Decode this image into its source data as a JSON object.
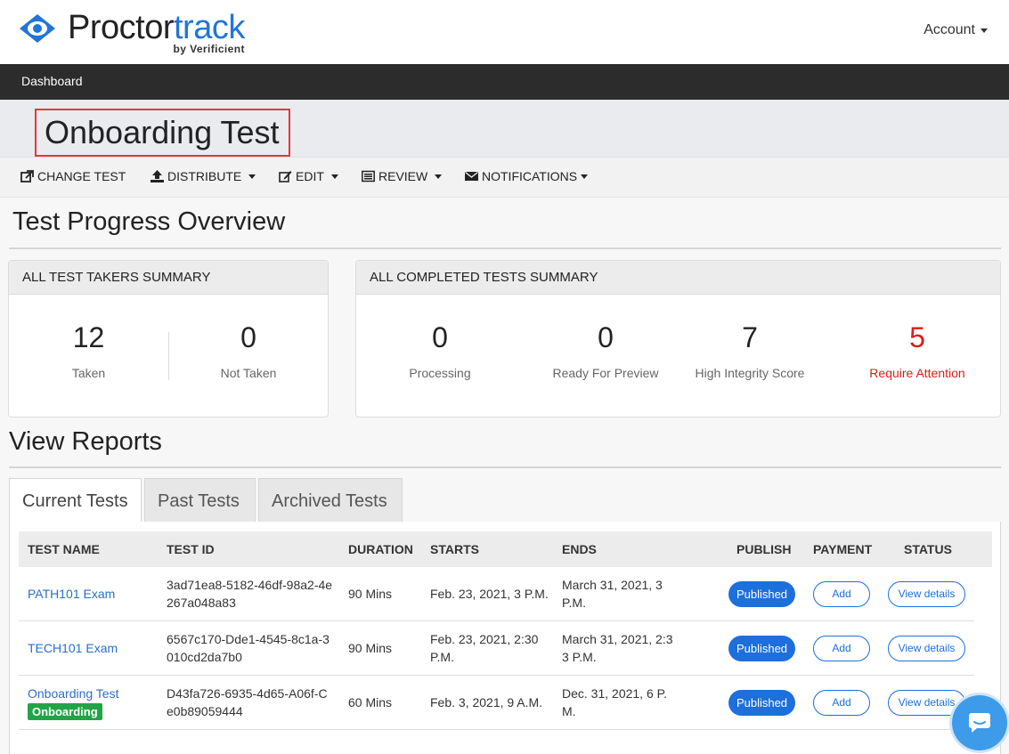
{
  "brand": {
    "name_main": "Proctor",
    "name_accent": "track",
    "tagline": "by Verificient",
    "accent_color": "#2275d7"
  },
  "header": {
    "account_label": "Account"
  },
  "nav": {
    "dashboard_label": "Dashboard"
  },
  "page": {
    "title": "Onboarding Test"
  },
  "toolbar": {
    "change_test": "CHANGE TEST",
    "distribute": "DISTRIBUTE",
    "edit": "EDIT",
    "review": "REVIEW",
    "notifications": "NOTIFICATIONS"
  },
  "progress": {
    "heading": "Test Progress Overview",
    "takers_card": {
      "title": "ALL TEST TAKERS SUMMARY",
      "stats": [
        {
          "value": "12",
          "label": "Taken"
        },
        {
          "value": "0",
          "label": "Not Taken"
        }
      ]
    },
    "completed_card": {
      "title": "ALL COMPLETED TESTS SUMMARY",
      "stats": [
        {
          "value": "0",
          "label": "Processing"
        },
        {
          "value": "0",
          "label": "Ready For Preview"
        },
        {
          "value": "7",
          "label": "High Integrity Score"
        },
        {
          "value": "5",
          "label": "Require Attention",
          "color": "#e01b1b"
        }
      ]
    }
  },
  "reports": {
    "heading": "View Reports",
    "tabs": [
      {
        "label": "Current Tests",
        "active": true
      },
      {
        "label": "Past Tests",
        "active": false
      },
      {
        "label": "Archived Tests",
        "active": false
      }
    ],
    "columns": [
      "TEST NAME",
      "TEST ID",
      "DURATION",
      "STARTS",
      "ENDS",
      "PUBLISH",
      "PAYMENT",
      "STATUS"
    ],
    "rows": [
      {
        "name": "PATH101 Exam",
        "badge": "",
        "id_line1": "3ad71ea8-5182-46df-98a2-4e",
        "id_line2": "267a048a83",
        "duration": "90 Mins",
        "starts_line1": "Feb. 23, 2021, 3 P.M.",
        "starts_line2": "",
        "ends_line1": "March 31, 2021, 3",
        "ends_line2": "P.M.",
        "publish": "Published",
        "payment": "Add",
        "status": "View details"
      },
      {
        "name": "TECH101 Exam",
        "badge": "",
        "id_line1": "6567c170-Dde1-4545-8c1a-3",
        "id_line2": "010cd2da7b0",
        "duration": "90 Mins",
        "starts_line1": "Feb. 23, 2021, 2:30",
        "starts_line2": "P.M.",
        "ends_line1": "March 31, 2021, 2:3",
        "ends_line2": "3 P.M.",
        "publish": "Published",
        "payment": "Add",
        "status": "View details"
      },
      {
        "name": "Onboarding Test",
        "badge": "Onboarding",
        "id_line1": "D43fa726-6935-4d65-A06f-C",
        "id_line2": "e0b89059444",
        "duration": "60 Mins",
        "starts_line1": "Feb. 3, 2021, 9 A.M.",
        "starts_line2": "",
        "ends_line1": "Dec. 31, 2021, 6 P.",
        "ends_line2": "M.",
        "publish": "Published",
        "payment": "Add",
        "status": "View details"
      }
    ]
  }
}
